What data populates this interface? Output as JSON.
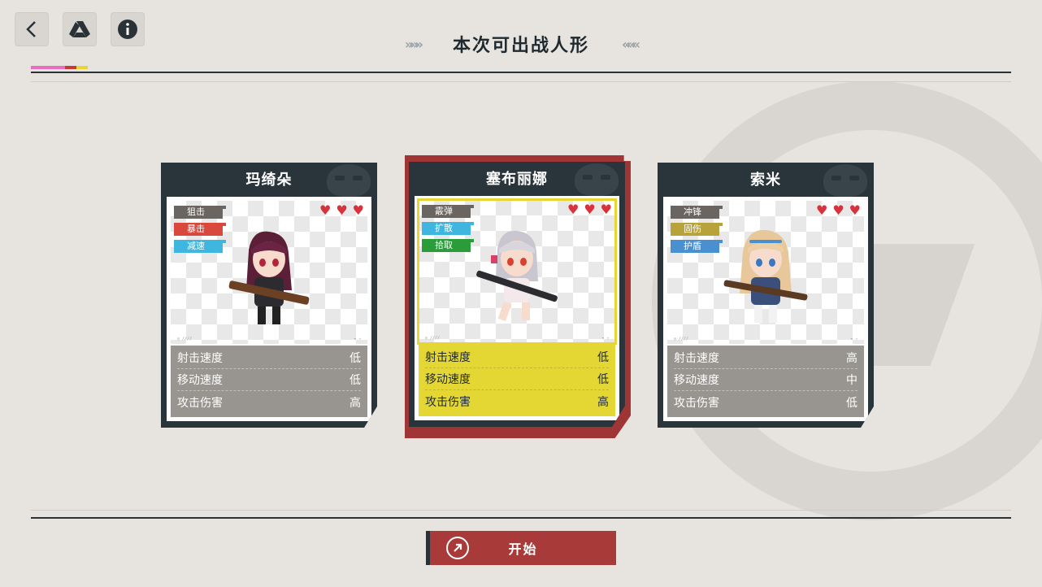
{
  "header": {
    "title": "本次可出战人形",
    "left_chevrons": "»»»",
    "right_chevrons": "«««",
    "top_buttons": [
      {
        "icon": "back-arrow-icon"
      },
      {
        "icon": "drive-triangle-icon"
      },
      {
        "icon": "info-icon"
      }
    ],
    "color_bar": [
      "#e86fc0",
      "#e86fc0",
      "#c53b3b",
      "#e6d534"
    ]
  },
  "cards": [
    {
      "name": "玛绮朵",
      "selected": false,
      "tags": [
        {
          "label": "狙击",
          "color": "#6a6560"
        },
        {
          "label": "暴击",
          "color": "#d9483c"
        },
        {
          "label": "减速",
          "color": "#3fb6df"
        }
      ],
      "hearts": 3,
      "stats": [
        {
          "label": "射击速度",
          "value": "低"
        },
        {
          "label": "移动速度",
          "value": "低"
        },
        {
          "label": "攻击伤害",
          "value": "高"
        }
      ]
    },
    {
      "name": "塞布丽娜",
      "selected": true,
      "tags": [
        {
          "label": "霰弹",
          "color": "#6a6560"
        },
        {
          "label": "扩散",
          "color": "#3fb6df"
        },
        {
          "label": "拾取",
          "color": "#2a9d3a"
        }
      ],
      "hearts": 3,
      "stats": [
        {
          "label": "射击速度",
          "value": "低"
        },
        {
          "label": "移动速度",
          "value": "低"
        },
        {
          "label": "攻击伤害",
          "value": "高"
        }
      ]
    },
    {
      "name": "索米",
      "selected": false,
      "tags": [
        {
          "label": "冲锋",
          "color": "#6a6560"
        },
        {
          "label": "固伤",
          "color": "#b8a23a"
        },
        {
          "label": "护盾",
          "color": "#4a8fd0"
        }
      ],
      "hearts": 3,
      "stats": [
        {
          "label": "射击速度",
          "value": "高"
        },
        {
          "label": "移动速度",
          "value": "中"
        },
        {
          "label": "攻击伤害",
          "value": "低"
        }
      ]
    }
  ],
  "start_button": {
    "label": "开始",
    "icon": "arrow-circle-icon"
  }
}
